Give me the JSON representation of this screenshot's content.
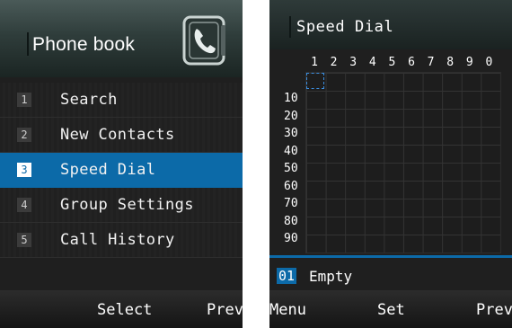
{
  "phonebook": {
    "title": "Phone book",
    "icon": "contact-book-icon",
    "menu": [
      {
        "num": "1",
        "label": "Search"
      },
      {
        "num": "2",
        "label": "New Contacts"
      },
      {
        "num": "3",
        "label": "Speed Dial",
        "selected": true
      },
      {
        "num": "4",
        "label": "Group Settings"
      },
      {
        "num": "5",
        "label": "Call History"
      }
    ],
    "softkeys": {
      "center": "Select",
      "right": "Prev"
    }
  },
  "speed_dial": {
    "title": "Speed Dial",
    "columns": [
      "1",
      "2",
      "3",
      "4",
      "5",
      "6",
      "7",
      "8",
      "9",
      "0"
    ],
    "rows": [
      "10",
      "20",
      "30",
      "40",
      "50",
      "60",
      "70",
      "80",
      "90"
    ],
    "selected_number": "01",
    "selected_status": "Empty",
    "softkeys": {
      "left": "Menu",
      "center": "Set",
      "right": "Prev"
    }
  },
  "colors": {
    "highlight": "#0c6aa8",
    "background": "#1f1f1f"
  }
}
